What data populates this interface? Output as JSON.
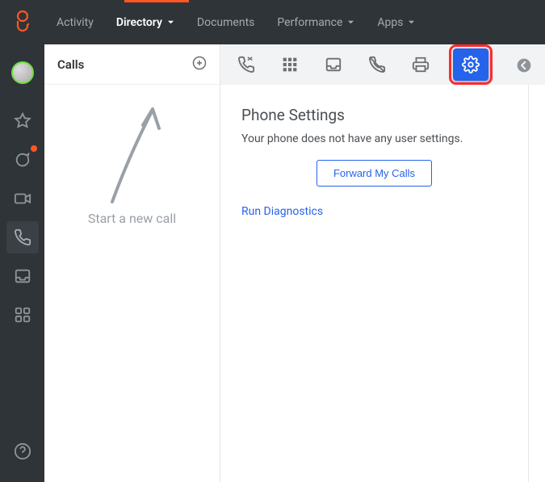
{
  "nav": {
    "activity": "Activity",
    "directory": "Directory",
    "documents": "Documents",
    "performance": "Performance",
    "apps": "Apps"
  },
  "calls": {
    "title": "Calls",
    "start_text": "Start a new call"
  },
  "settings": {
    "title": "Phone Settings",
    "desc": "Your phone does not have any user settings.",
    "forward_btn": "Forward My Calls",
    "diag_link": "Run Diagnostics"
  }
}
